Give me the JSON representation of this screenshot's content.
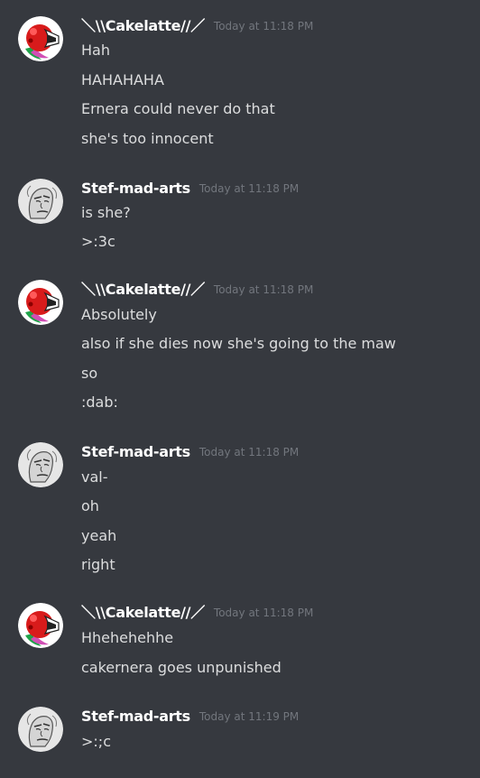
{
  "messages": [
    {
      "author": "＼\\\\Cakelatte//／",
      "avatar_icon": "red-creature-avatar-icon",
      "timestamp": "Today at 11:18 PM",
      "lines": [
        "Hah",
        "HAHAHAHA",
        "Ernera could never do that",
        "she's too innocent"
      ]
    },
    {
      "author": "Stef-mad-arts",
      "avatar_icon": "sketch-face-avatar-icon",
      "timestamp": "Today at 11:18 PM",
      "lines": [
        "is she?",
        ">:3c"
      ]
    },
    {
      "author": "＼\\\\Cakelatte//／",
      "avatar_icon": "red-creature-avatar-icon",
      "timestamp": "Today at 11:18 PM",
      "lines": [
        "Absolutely",
        "also if she dies now she's going to the maw",
        "so",
        ":dab:"
      ]
    },
    {
      "author": "Stef-mad-arts",
      "avatar_icon": "sketch-face-avatar-icon",
      "timestamp": "Today at 11:18 PM",
      "lines": [
        "val-",
        "oh",
        "yeah",
        "right"
      ]
    },
    {
      "author": "＼\\\\Cakelatte//／",
      "avatar_icon": "red-creature-avatar-icon",
      "timestamp": "Today at 11:18 PM",
      "lines": [
        "Hhehehehhe",
        "cakernera goes unpunished"
      ]
    },
    {
      "author": "Stef-mad-arts",
      "avatar_icon": "sketch-face-avatar-icon",
      "timestamp": "Today at 11:19 PM",
      "lines": [
        ">:;c"
      ]
    }
  ],
  "colors": {
    "background": "#36393f",
    "username": "#ffffff",
    "message_text": "#dcddde",
    "timestamp": "#72767d"
  }
}
